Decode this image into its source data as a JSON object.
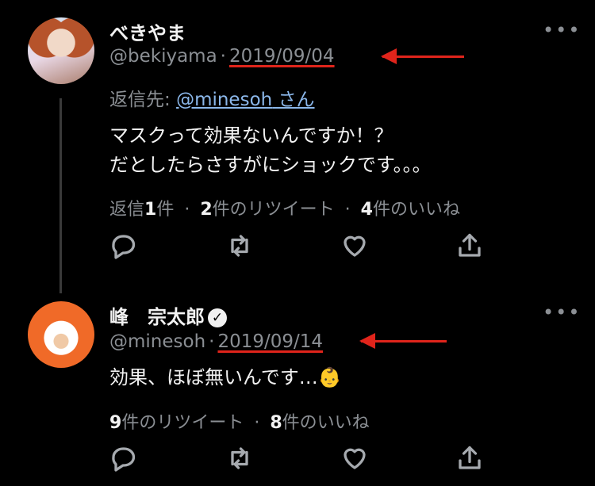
{
  "tweet1": {
    "name": "べきやま",
    "handle": "@bekiyama",
    "sep": "·",
    "date": "2019/09/04",
    "reply_prefix": "返信先: ",
    "reply_to": "@minesoh",
    "reply_suffix": " さん",
    "text_line1": "マスクって効果ないんですか！？",
    "text_line2": "だとしたらさすがにショックです。。。",
    "stats": {
      "replies_label": "返信",
      "replies_count": "1",
      "replies_unit": "件",
      "sep": "·",
      "retweets_count": "2",
      "retweets_label": "件のリツイート",
      "likes_count": "4",
      "likes_label": "件のいいね"
    }
  },
  "tweet2": {
    "name": "峰　宗太郎",
    "handle": "@minesoh",
    "sep": "·",
    "date": "2019/09/14",
    "text": "効果、ほぼ無いんです…👶",
    "stats": {
      "retweets_count": "9",
      "retweets_label": "件のリツイート",
      "sep": "·",
      "likes_count": "8",
      "likes_label": "件のいいね"
    }
  },
  "more_label": "•••",
  "icons": {
    "reply": "reply-icon",
    "retweet": "retweet-icon",
    "like": "heart-icon",
    "share": "share-icon",
    "verified": "verified-badge-icon"
  },
  "colors": {
    "background": "#000000",
    "annotation_red": "#e0241b",
    "link": "#8bb7ea",
    "muted": "#8b8f94"
  }
}
